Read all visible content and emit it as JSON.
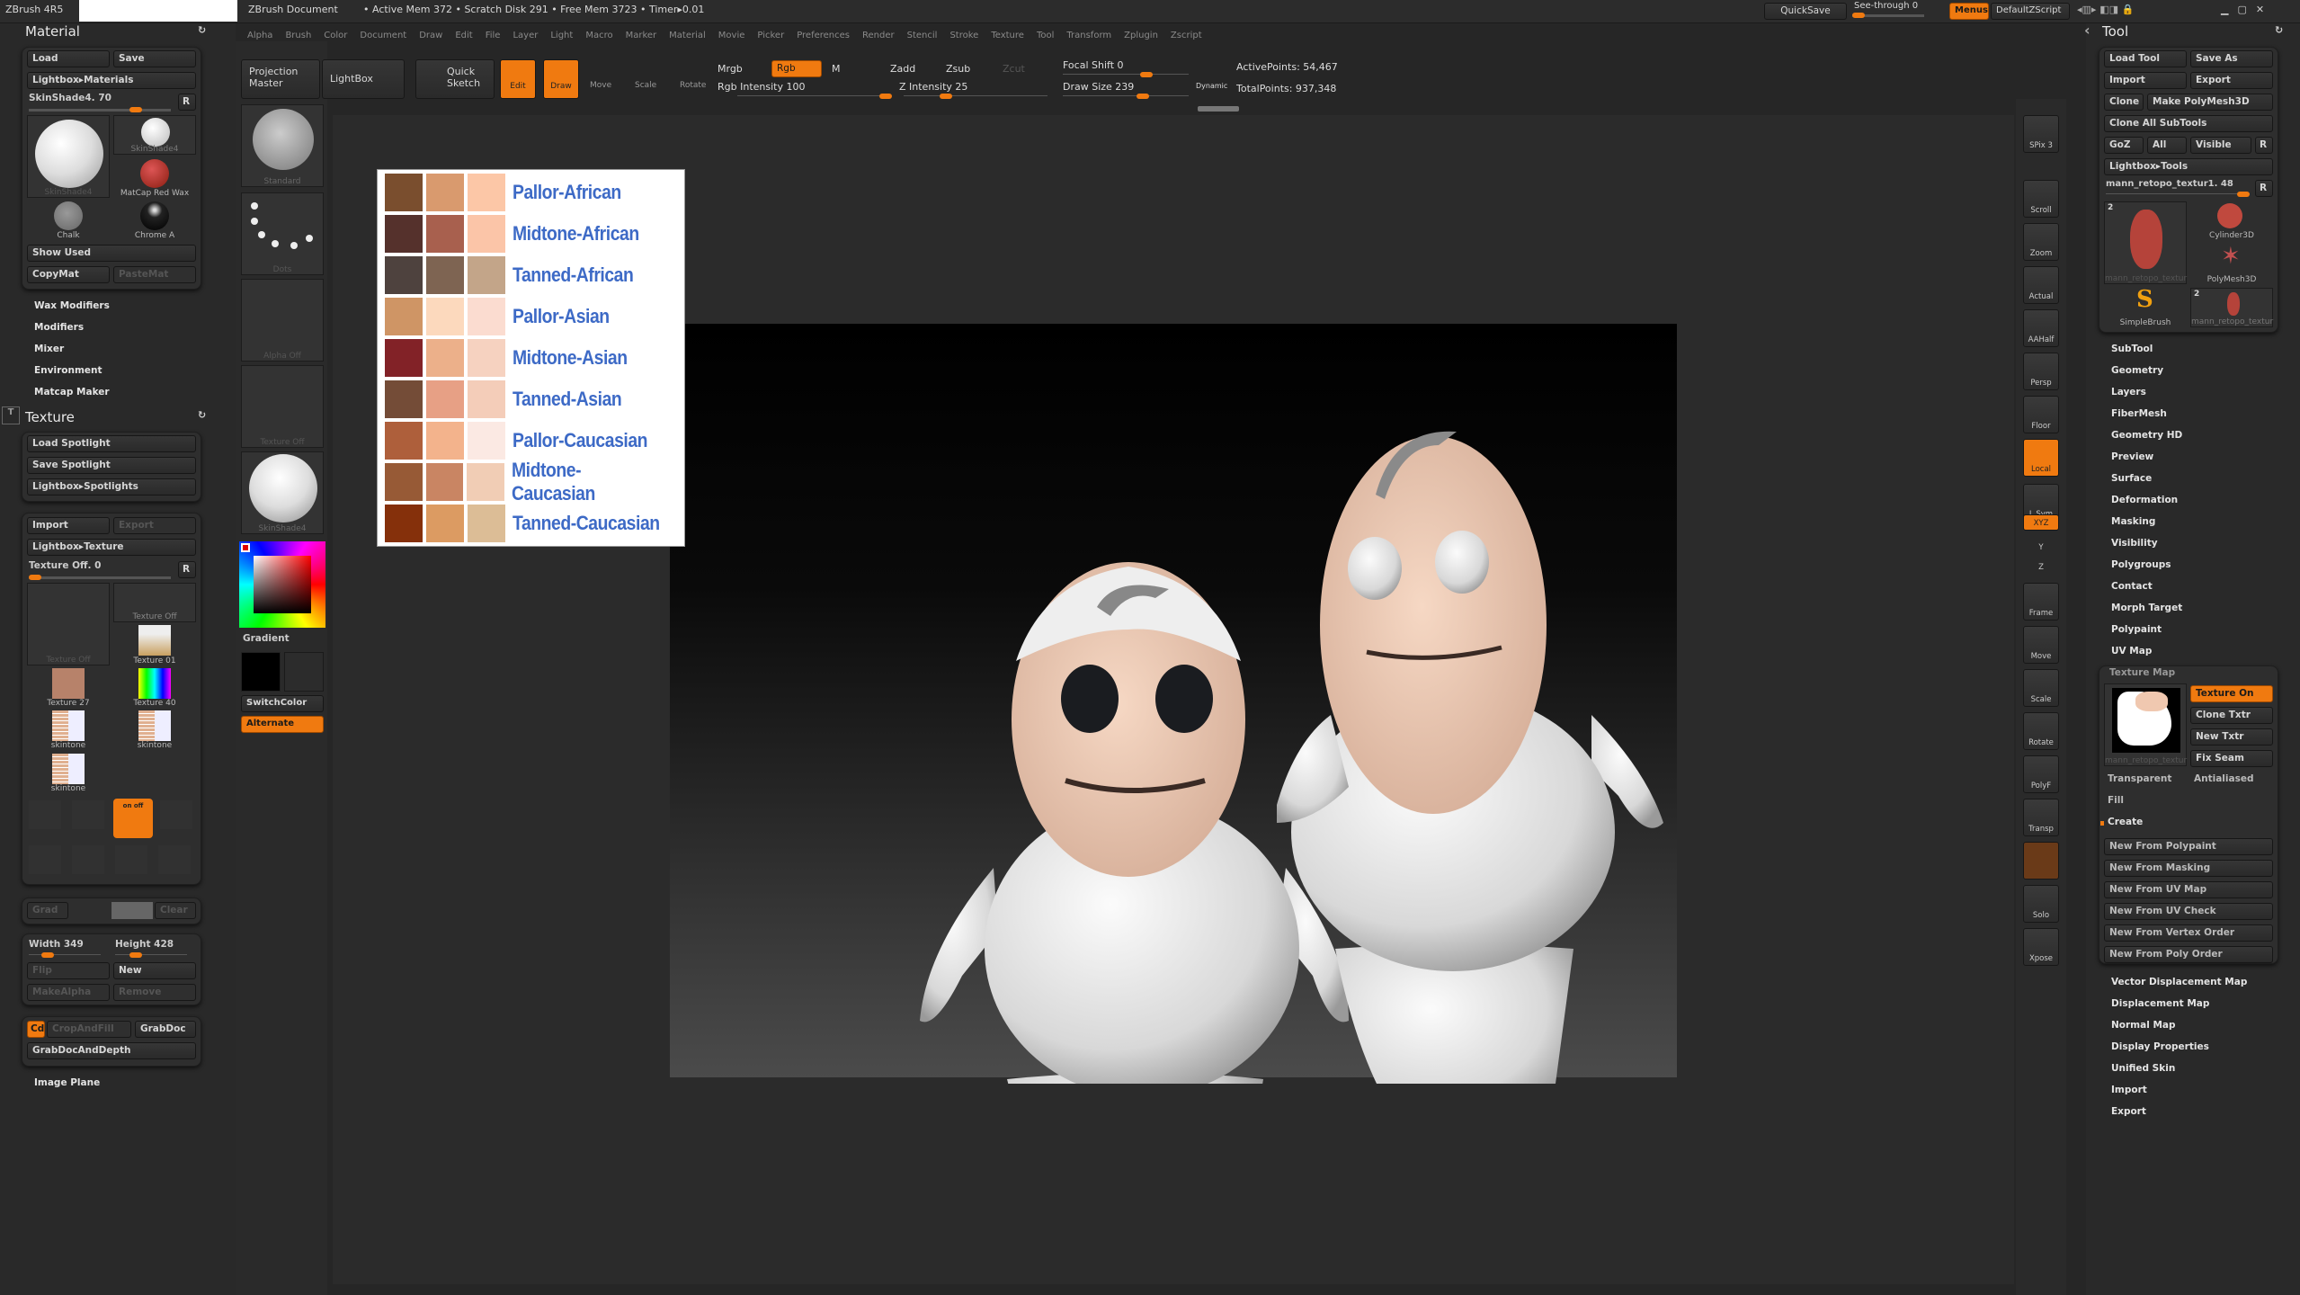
{
  "titlebar": {
    "app": "ZBrush 4R5",
    "doc": "ZBrush Document",
    "stats": "• Active Mem 372 • Scratch Disk 291 • Free Mem 3723 • Timer▸0.01",
    "quicksave": "QuickSave",
    "seethrough": "See-through  0",
    "menus": "Menus",
    "script": "DefaultZScript"
  },
  "menubar": [
    "Alpha",
    "Brush",
    "Color",
    "Document",
    "Draw",
    "Edit",
    "File",
    "Layer",
    "Light",
    "Macro",
    "Marker",
    "Material",
    "Movie",
    "Picker",
    "Preferences",
    "Render",
    "Stencil",
    "Stroke",
    "Texture",
    "Tool",
    "Transform",
    "Zplugin",
    "Zscript"
  ],
  "toolbar": {
    "projection_master": "Projection Master",
    "lightbox": "LightBox",
    "quick_sketch": "Quick Sketch",
    "edit": "Edit",
    "draw": "Draw",
    "move": "Move",
    "scale": "Scale",
    "rotate": "Rotate",
    "mrgb": "Mrgb",
    "rgb": "Rgb",
    "m": "M",
    "zadd": "Zadd",
    "zsub": "Zsub",
    "zcut": "Zcut",
    "rgb_intensity": "Rgb Intensity 100",
    "z_intensity": "Z Intensity 25",
    "focal_shift": "Focal Shift 0",
    "draw_size": "Draw Size 239",
    "dynamic": "Dynamic",
    "active_points": "ActivePoints: 54,467",
    "total_points": "TotalPoints: 937,348",
    "rgb_intensity_value": 100,
    "z_intensity_value": 25,
    "draw_size_value": 239
  },
  "material": {
    "title": "Material",
    "load": "Load",
    "save": "Save",
    "lightbox": "Lightbox▸Materials",
    "slider": "SkinShade4. 70",
    "r": "R",
    "thumbs": [
      "SkinShade4",
      "SkinShade4",
      "MatCap Red Wax",
      "Chalk",
      "Chrome A"
    ],
    "show_used": "Show Used",
    "copymat": "CopyMat",
    "pastemat": "PasteMat",
    "sections": [
      "Wax Modifiers",
      "Modifiers",
      "Mixer",
      "Environment",
      "Matcap Maker"
    ]
  },
  "texture": {
    "title": "Texture",
    "load_spot": "Load Spotlight",
    "save_spot": "Save Spotlight",
    "lightbox_spot": "Lightbox▸Spotlights",
    "import": "Import",
    "export": "Export",
    "lightbox": "Lightbox▸Texture",
    "slider": "Texture Off. 0",
    "r": "R",
    "thumbs": [
      "Texture Off",
      "Texture Off",
      "Texture 01",
      "Texture 27",
      "Texture 40",
      "skintone",
      "skintone",
      "skintone"
    ],
    "onoff": "on  off",
    "grad": "Grad",
    "clear": "Clear",
    "width": "Width 349",
    "height": "Height 428",
    "flip": "Flip",
    "new": "New",
    "makealpha": "MakeAlpha",
    "remove": "Remove",
    "cd": "Cd",
    "cropfill": "CropAndFill",
    "grabdoc": "GrabDoc",
    "grabdepth": "GrabDocAndDepth",
    "image_plane": "Image Plane"
  },
  "shelf": {
    "standard": "Standard",
    "dots": "Dots",
    "alpha_off": "Alpha Off",
    "texture_off": "Texture Off",
    "material": "SkinShade4",
    "gradient": "Gradient",
    "switchcolor": "SwitchColor",
    "alternate": "Alternate"
  },
  "palette": {
    "rows": [
      {
        "label": "Pallor-African",
        "colors": [
          "#7a4e2e",
          "#d99a6e",
          "#fcc7a7"
        ]
      },
      {
        "label": "Midtone-African",
        "colors": [
          "#55312c",
          "#a8604e",
          "#fbc5a8"
        ]
      },
      {
        "label": "Tanned-African",
        "colors": [
          "#4e423e",
          "#7e6452",
          "#c3a589"
        ]
      },
      {
        "label": "Pallor-Asian",
        "colors": [
          "#cf9565",
          "#fcd9bd",
          "#fbdcd0"
        ]
      },
      {
        "label": "Midtone-Asian",
        "colors": [
          "#822227",
          "#ecb08a",
          "#f6d2c0"
        ]
      },
      {
        "label": "Tanned-Asian",
        "colors": [
          "#744c37",
          "#e7a085",
          "#f4cdb9"
        ]
      },
      {
        "label": "Pallor-Caucasian",
        "colors": [
          "#ae5f3b",
          "#f3b38c",
          "#fbe9e3"
        ]
      },
      {
        "label": "Midtone-Caucasian",
        "colors": [
          "#975a36",
          "#c98563",
          "#f1cdb5"
        ]
      },
      {
        "label": "Tanned-Caucasian",
        "colors": [
          "#85300b",
          "#dc9b62",
          "#dcbd96"
        ]
      }
    ]
  },
  "rightshelf": [
    "SPix 3",
    "Scroll",
    "Zoom",
    "Actual",
    "AAHalf",
    "Persp",
    "Floor",
    "Local",
    "L.Sym",
    "XYZ",
    "Y",
    "Z",
    "Frame",
    "Move",
    "Scale",
    "Rotate",
    "PolyF",
    "Transp",
    "",
    "Solo",
    "Xpose"
  ],
  "tool": {
    "title": "Tool",
    "load": "Load Tool",
    "saveas": "Save As",
    "import": "Import",
    "export": "Export",
    "clone": "Clone",
    "make_poly": "Make PolyMesh3D",
    "clone_all": "Clone All SubTools",
    "goz": "GoZ",
    "all": "All",
    "visible": "Visible",
    "r": "R",
    "lightbox": "Lightbox▸Tools",
    "slider": "mann_retopo_textur1. 48",
    "thumbs": [
      "mann_retopo_textur",
      "Cylinder3D",
      "PolyMesh3D",
      "SimpleBrush",
      "mann_retopo_textur"
    ],
    "thumb_count": "2",
    "sections": [
      "SubTool",
      "Geometry",
      "Layers",
      "FiberMesh",
      "Geometry HD",
      "Preview",
      "Surface",
      "Deformation",
      "Masking",
      "Visibility",
      "Polygroups",
      "Contact",
      "Morph Target",
      "Polypaint",
      "UV Map"
    ],
    "texture_map": {
      "title": "Texture Map",
      "thumb": "mann_retopo_textur",
      "texture_on": "Texture On",
      "clone": "Clone Txtr",
      "new": "New Txtr",
      "fix": "Fix Seam",
      "transparent": "Transparent",
      "antialiased": "Antialiased",
      "fill": "Fill",
      "create": "Create",
      "create_items": [
        "New From Polypaint",
        "New From Masking",
        "New From UV Map",
        "New From UV Check",
        "New From Vertex Order",
        "New From Poly Order"
      ]
    },
    "sections2": [
      "Vector Displacement Map",
      "Displacement Map",
      "Normal Map",
      "Display Properties",
      "Unified Skin",
      "Import",
      "Export"
    ]
  },
  "colors": {
    "accent": "#f07a10",
    "palette_text": "#3d6ac6",
    "skin": "#f0cdb8"
  }
}
